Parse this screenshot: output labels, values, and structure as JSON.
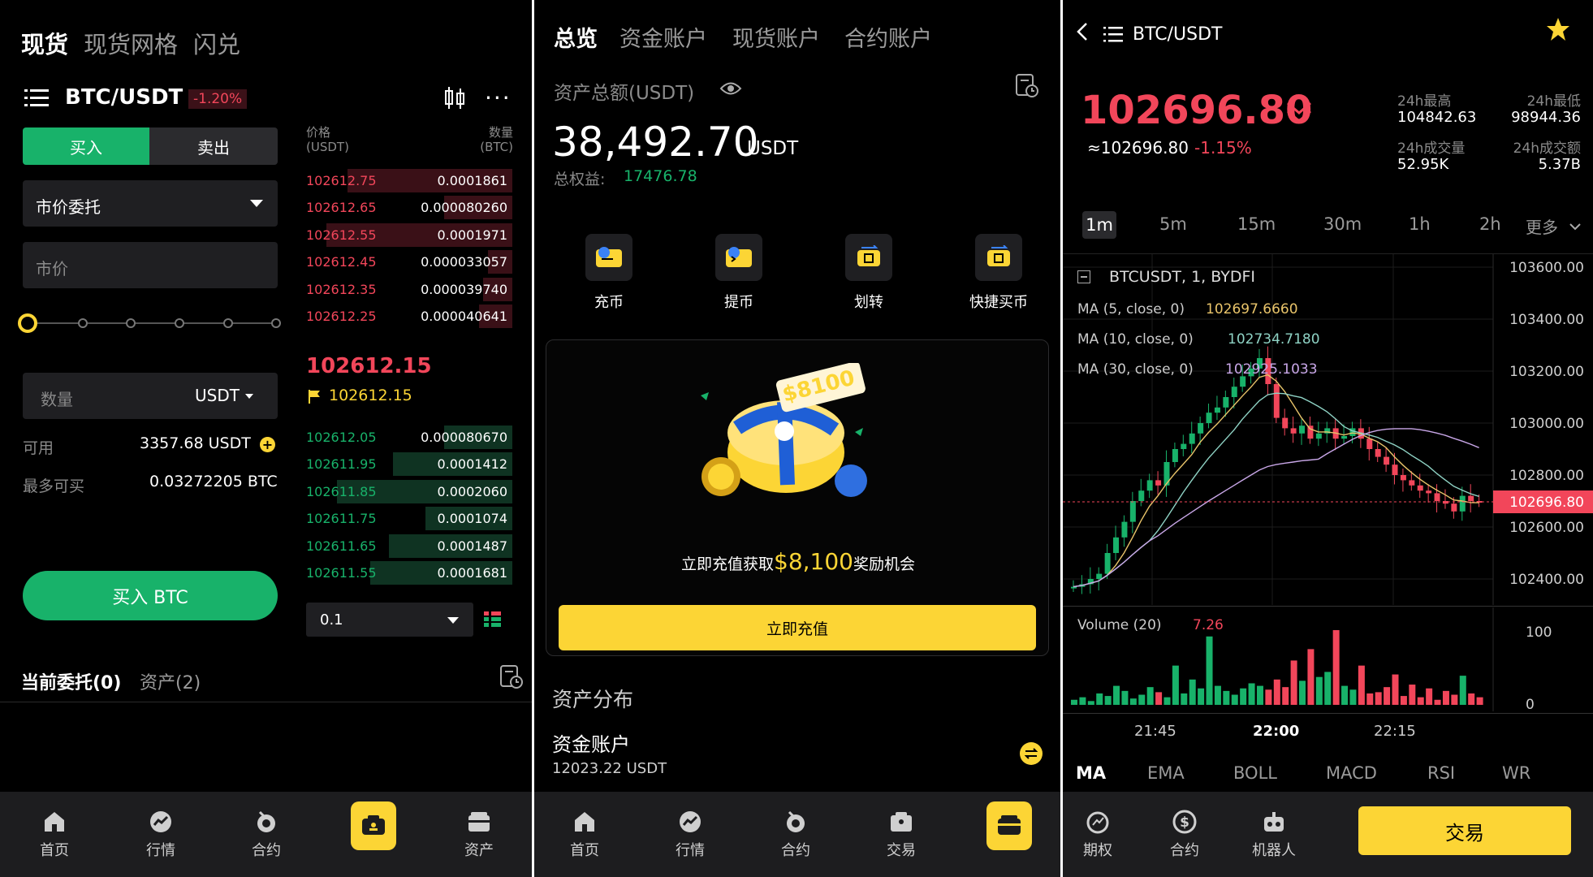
{
  "panel1": {
    "tabs": [
      "现货",
      "现货网格",
      "闪兑"
    ],
    "pair": "BTC/USDT",
    "change": "-1.20%",
    "buy_tab": "买入",
    "sell_tab": "卖出",
    "order_type": "市价委托",
    "price_placeholder": "市价",
    "qty_label": "数量",
    "qty_unit": "USDT",
    "available_label": "可用",
    "available_value": "3357.68 USDT",
    "max_label": "最多可买",
    "max_value": "0.03272205 BTC",
    "buy_button": "买入 BTC",
    "ob_price_header": "价格",
    "ob_price_unit": "(USDT)",
    "ob_qty_header": "数量",
    "ob_qty_unit": "(BTC)",
    "asks": [
      {
        "price": "102612.75",
        "qty": "0.0001861",
        "depth": 0.8
      },
      {
        "price": "102612.65",
        "qty": "0.000080260",
        "depth": 0.33
      },
      {
        "price": "102612.55",
        "qty": "0.0001971",
        "depth": 0.9
      },
      {
        "price": "102612.45",
        "qty": "0.000033057",
        "depth": 0.12
      },
      {
        "price": "102612.35",
        "qty": "0.000039740",
        "depth": 0.14
      },
      {
        "price": "102612.25",
        "qty": "0.000040641",
        "depth": 0.16
      }
    ],
    "mid_price": "102612.15",
    "mark_price": "102612.15",
    "bids": [
      {
        "price": "102612.05",
        "qty": "0.000080670",
        "depth": 0.33
      },
      {
        "price": "102611.95",
        "qty": "0.0001412",
        "depth": 0.58
      },
      {
        "price": "102611.85",
        "qty": "0.0002060",
        "depth": 0.85
      },
      {
        "price": "102611.75",
        "qty": "0.0001074",
        "depth": 0.42
      },
      {
        "price": "102611.65",
        "qty": "0.0001487",
        "depth": 0.6
      },
      {
        "price": "102611.55",
        "qty": "0.0001681",
        "depth": 0.69
      }
    ],
    "precision": "0.1",
    "orders_tab": "当前委托(0)",
    "assets_tab": "资产(2)",
    "nav": [
      "首页",
      "行情",
      "合约",
      "",
      "资产"
    ]
  },
  "panel2": {
    "tabs": [
      "总览",
      "资金账户",
      "现货账户",
      "合约账户"
    ],
    "total_label": "资产总额(USDT)",
    "total_value": "38,492.70",
    "total_unit": "USDT",
    "equity_label": "总权益:",
    "equity_value": "17476.78",
    "actions": [
      "充币",
      "提币",
      "划转",
      "快捷买币"
    ],
    "promo_badge": "$8100",
    "promo_text_1": "立即充值获取",
    "promo_amount": "$8,100",
    "promo_text_2": "奖励机会",
    "promo_button": "立即充值",
    "dist_title": "资产分布",
    "account_name": "资金账户",
    "account_value": "12023.22 USDT",
    "nav": [
      "首页",
      "行情",
      "合约",
      "交易",
      ""
    ]
  },
  "panel3": {
    "pair": "BTC/USDT",
    "price": "102696.80",
    "price_sub": "≈102696.80",
    "change": "-1.15%",
    "high_label": "24h最高",
    "high_value": "104842.63",
    "low_label": "24h最低",
    "low_value": "98944.36",
    "vol_label": "24h成交量",
    "vol_value": "52.95K",
    "amount_label": "24h成交额",
    "amount_value": "5.37B",
    "intervals": [
      "1m",
      "5m",
      "15m",
      "30m",
      "1h",
      "2h",
      "更多"
    ],
    "symbol_line": "BTCUSDT, 1, BYDFI",
    "ma5_label": "MA (5, close, 0)",
    "ma5_value": "102697.6660",
    "ma10_label": "MA (10, close, 0)",
    "ma10_value": "102734.7180",
    "ma30_label": "MA (30, close, 0)",
    "ma30_value": "102925.1033",
    "y_ticks": [
      "103600.00",
      "103400.00",
      "103200.00",
      "103000.00",
      "102800.00",
      "102600.00",
      "102400.00"
    ],
    "current_tag": "102696.80",
    "volume_label": "Volume (20)",
    "volume_value": "7.26",
    "vol_ticks": [
      "100",
      "0"
    ],
    "x_ticks": [
      "21:45",
      "22:00",
      "22:15"
    ],
    "indicators": [
      "MA",
      "EMA",
      "BOLL",
      "MACD",
      "RSI",
      "WR"
    ],
    "nav": [
      "期权",
      "合约",
      "机器人"
    ],
    "trade_button": "交易"
  },
  "colors": {
    "green": "#18b26a",
    "red": "#f2465a",
    "yellow": "#fcd535"
  }
}
